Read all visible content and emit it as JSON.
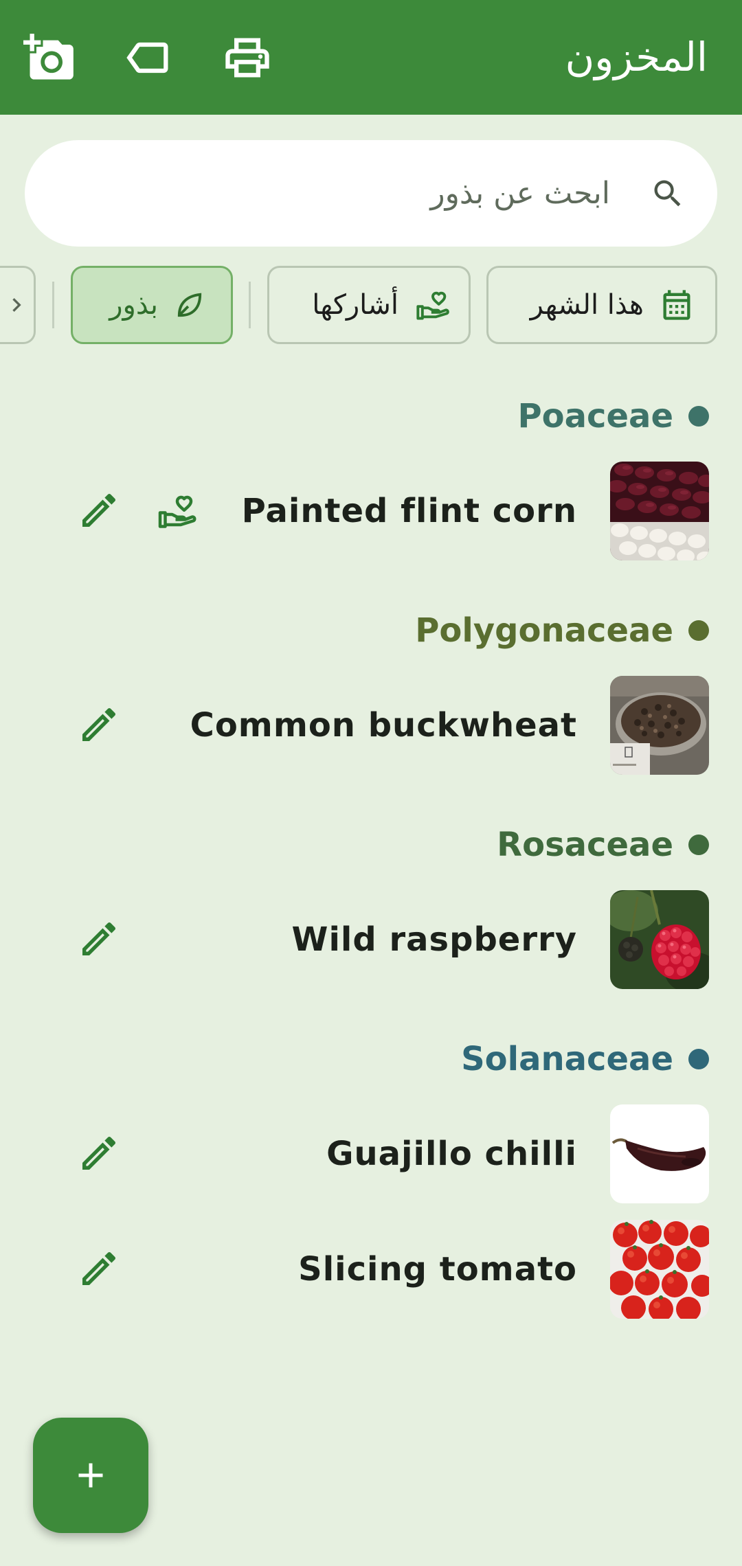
{
  "appbar": {
    "title": "المخزون",
    "actions": [
      "add-photo-icon",
      "label-icon",
      "print-icon"
    ]
  },
  "search": {
    "placeholder": "ابحث عن بذور",
    "icon": "search-icon"
  },
  "filters": [
    {
      "label": "هذا الشهر",
      "icon": "calendar-icon",
      "selected": false
    },
    {
      "label": "أشاركها",
      "icon": "volunteer-heart-hand-icon",
      "selected": false
    },
    {
      "label": "بذور",
      "icon": "leaf-icon",
      "selected": true
    }
  ],
  "groups": [
    {
      "family": "Poaceae",
      "color": "#3e7369",
      "items": [
        {
          "name": "Painted flint corn",
          "shared": true
        }
      ]
    },
    {
      "family": "Polygonaceae",
      "color": "#5a6e30",
      "items": [
        {
          "name": "Common buckwheat",
          "shared": false
        }
      ]
    },
    {
      "family": "Rosaceae",
      "color": "#3f6a3d",
      "items": [
        {
          "name": "Wild raspberry",
          "shared": false
        }
      ]
    },
    {
      "family": "Solanaceae",
      "color": "#2f6879",
      "items": [
        {
          "name": "Guajillo chilli",
          "shared": false
        },
        {
          "name": "Slicing tomato",
          "shared": false
        }
      ]
    }
  ],
  "fab": {
    "icon": "plus-icon"
  },
  "colors": {
    "primary": "#3d8a3a",
    "background": "#e6f0e0",
    "chip_selected": "#c8e3bf"
  }
}
